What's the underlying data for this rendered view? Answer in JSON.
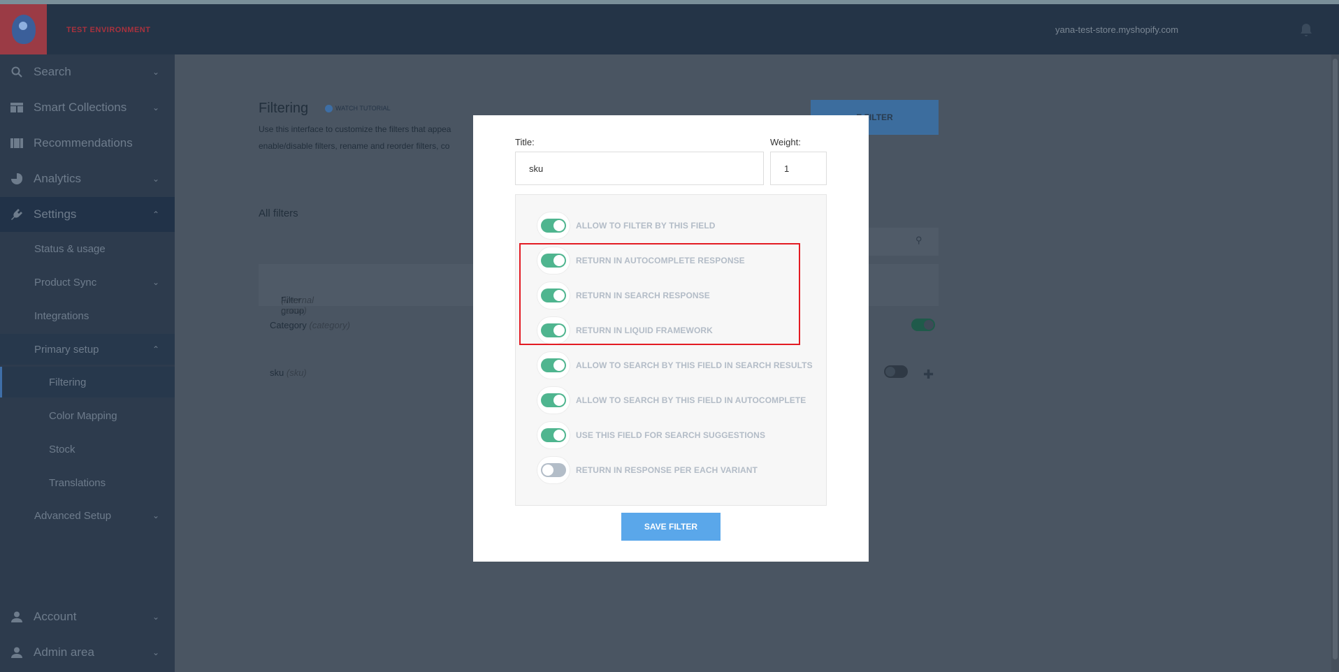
{
  "header": {
    "env_label": "TEST ENVIRONMENT",
    "store": "yana-test-store.myshopify.com",
    "bell_icon": "bell-icon"
  },
  "sidebar": {
    "items": [
      {
        "label": "Search",
        "icon": "search-icon"
      },
      {
        "label": "Smart Collections",
        "icon": "grid-icon"
      },
      {
        "label": "Recommendations",
        "icon": "film-icon"
      },
      {
        "label": "Analytics",
        "icon": "pie-chart-icon"
      },
      {
        "label": "Settings",
        "icon": "plug-icon"
      }
    ],
    "settings_sub": [
      {
        "label": "Status & usage"
      },
      {
        "label": "Product Sync"
      },
      {
        "label": "Integrations"
      },
      {
        "label": "Primary setup"
      },
      {
        "label": "Filtering"
      },
      {
        "label": "Color Mapping"
      },
      {
        "label": "Stock"
      },
      {
        "label": "Translations"
      },
      {
        "label": "Advanced Setup"
      }
    ],
    "bottom": [
      {
        "label": "Account",
        "icon": "user-icon"
      },
      {
        "label": "Admin area",
        "icon": "user-icon"
      }
    ]
  },
  "main": {
    "title": "Filtering",
    "tutorial": "WATCH TUTORIAL",
    "description_line1": "Use this interface to customize the filters that appea",
    "description_line2": "enable/disable filters, rename and reorder filters, co",
    "add_filter": "E FILTER",
    "all_filters": "All filters",
    "table_head": {
      "label": "Filter group",
      "hint": "(internal name)"
    },
    "rows": [
      {
        "label": "Category",
        "hint": "(category)"
      },
      {
        "label": "sku",
        "hint": "(sku)"
      }
    ]
  },
  "modal": {
    "title_label": "Title:",
    "title_value": "sku",
    "weight_label": "Weight:",
    "weight_value": "1",
    "options": [
      {
        "label": "ALLOW TO FILTER BY THIS FIELD",
        "on": true
      },
      {
        "label": "RETURN IN AUTOCOMPLETE RESPONSE",
        "on": true
      },
      {
        "label": "RETURN IN SEARCH RESPONSE",
        "on": true
      },
      {
        "label": "RETURN IN LIQUID FRAMEWORK",
        "on": true
      },
      {
        "label": "ALLOW TO SEARCH BY THIS FIELD IN SEARCH RESULTS",
        "on": true
      },
      {
        "label": "ALLOW TO SEARCH BY THIS FIELD IN AUTOCOMPLETE",
        "on": true
      },
      {
        "label": "USE THIS FIELD FOR SEARCH SUGGESTIONS",
        "on": true
      },
      {
        "label": "RETURN IN RESPONSE PER EACH VARIANT",
        "on": false
      }
    ],
    "save_label": "SAVE FILTER"
  },
  "colors": {
    "sidebar_bg": "#2d3b4d",
    "toggle_on": "#4fb58f",
    "toggle_off": "#b3bdc8",
    "save_button": "#5aa7ea",
    "highlight": "#e31b23"
  }
}
